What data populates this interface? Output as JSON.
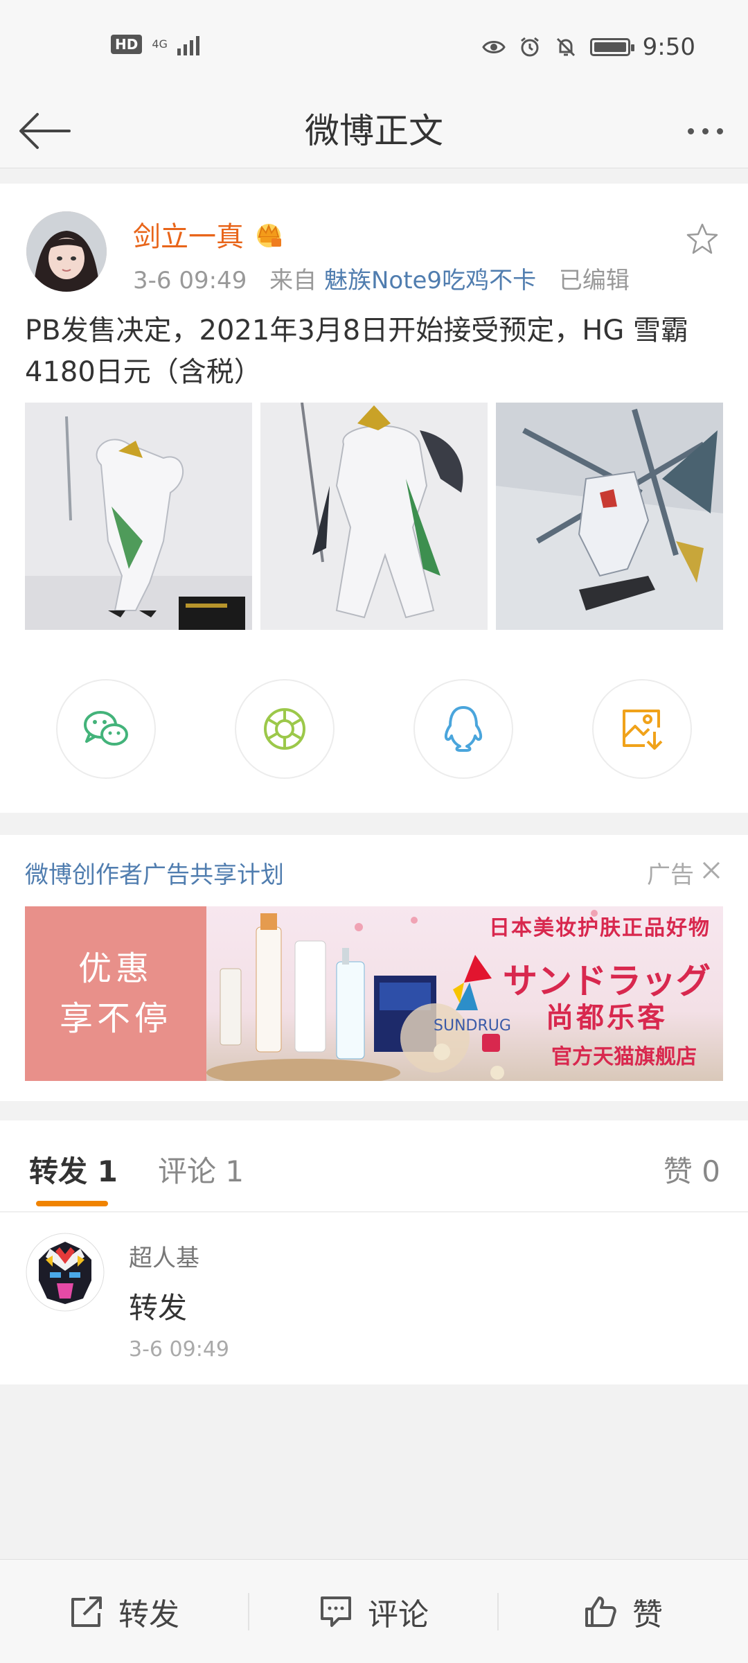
{
  "status_bar": {
    "hd": "HD",
    "network": "4G",
    "time": "9:50",
    "battery_level": 0.85
  },
  "nav": {
    "title": "微博正文"
  },
  "post": {
    "username": "剑立一真",
    "timestamp": "3-6 09:49",
    "from_label": "来自",
    "source": "魅族Note9吃鸡不卡",
    "edited": "已编辑",
    "text": "PB发售决定，2021年3月8日开始接受预定，HG 雪霸 4180日元（含税）",
    "images": [
      "robot-photo-1",
      "robot-photo-2",
      "robot-photo-3"
    ],
    "share_icons": [
      "wechat-icon",
      "moments-icon",
      "qq-icon",
      "save-image-icon"
    ]
  },
  "ad": {
    "title": "微博创作者广告共享计划",
    "label": "广告",
    "banner": {
      "left_line1": "优惠",
      "left_line2": "享不停",
      "top_text": "日本美妆护肤正品好物",
      "brand_jp": "サンドラッグ",
      "brand_cn": "尚都乐客",
      "sundrug": "SUNDRUG",
      "store": "官方天猫旗舰店"
    }
  },
  "tabs": {
    "repost": "转发 1",
    "comment": "评论 1",
    "like": "赞 0"
  },
  "repost_item": {
    "name": "超人基",
    "text": "转发",
    "time": "3-6 09:49"
  },
  "bottom_bar": {
    "repost": "转发",
    "comment": "评论",
    "like": "赞"
  },
  "colors": {
    "accent": "#f08300",
    "username": "#e8651a",
    "link": "#507daf"
  }
}
